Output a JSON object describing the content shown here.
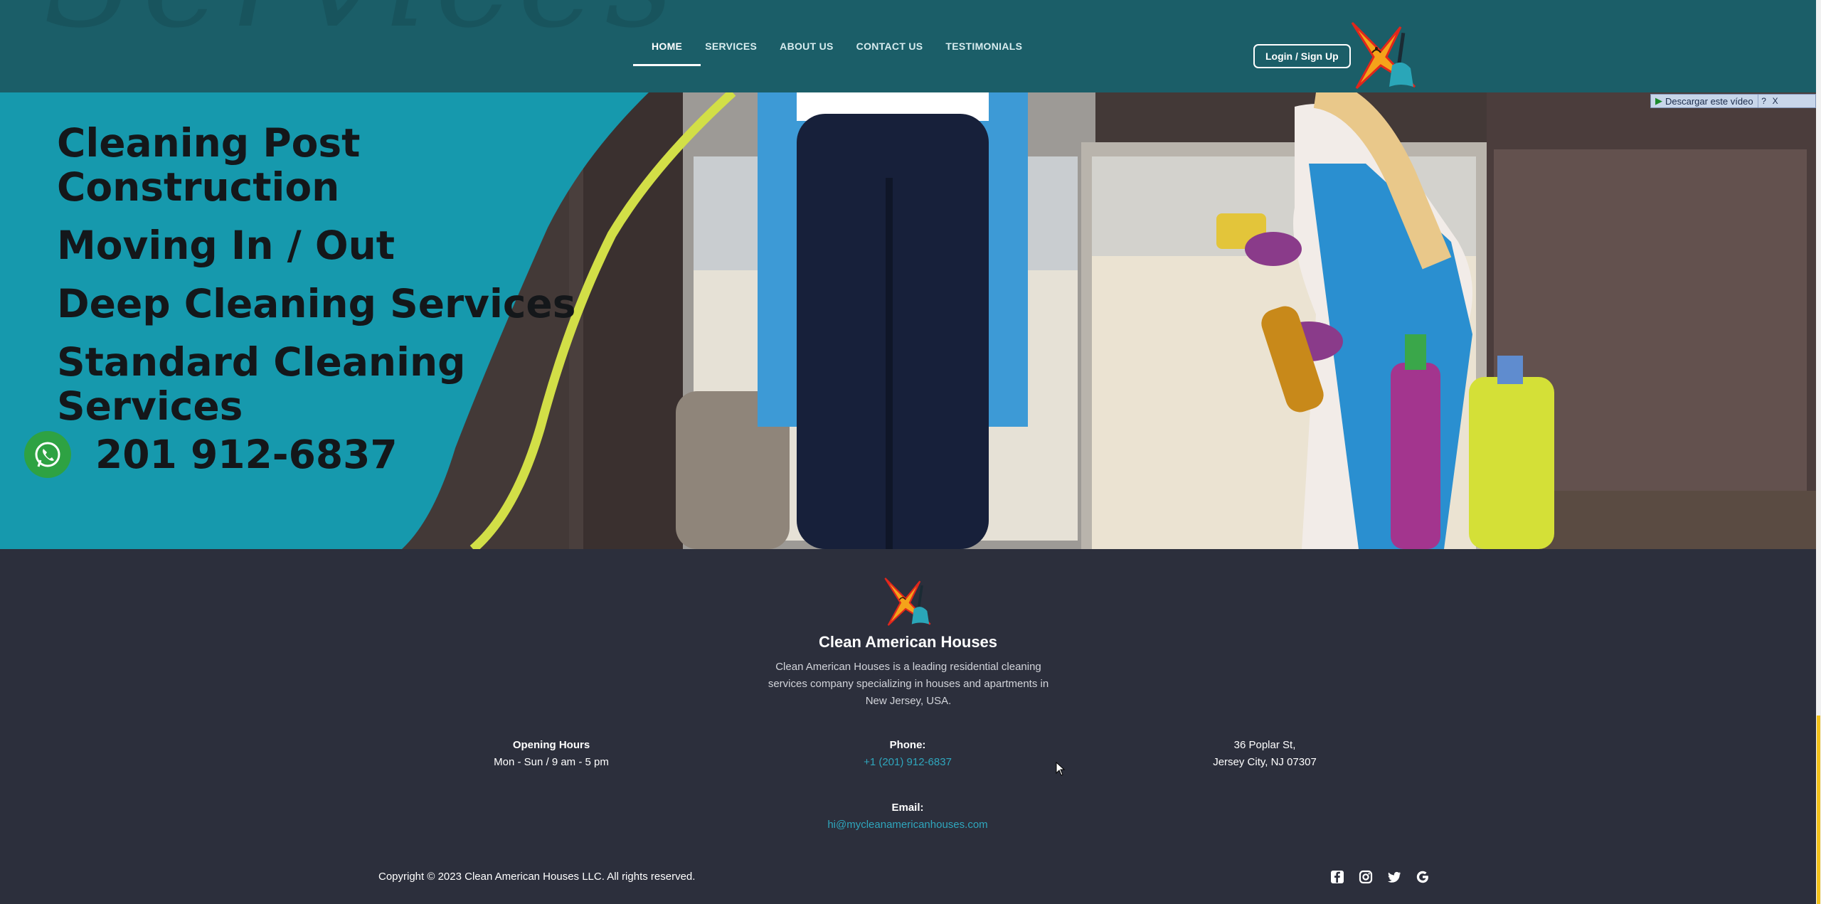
{
  "header": {
    "ghost_text": "Services",
    "nav": [
      {
        "label": "HOME",
        "active": true
      },
      {
        "label": "SERVICES",
        "active": false
      },
      {
        "label": "ABOUT US",
        "active": false
      },
      {
        "label": "CONTACT US",
        "active": false
      },
      {
        "label": "TESTIMONIALS",
        "active": false
      }
    ],
    "login_label": "Login / Sign Up",
    "logo_icon": "brand-logo-icon"
  },
  "hero": {
    "lines": [
      "Cleaning Post Construction",
      "Moving In / Out",
      "Deep Cleaning Services",
      "Standard Cleaning Services"
    ],
    "phone": "201 912-6837",
    "whatsapp_icon": "whatsapp-icon",
    "download_bar": {
      "label": "Descargar este vídeo",
      "help": "?",
      "close": "X"
    }
  },
  "footer": {
    "brand": "Clean American Houses",
    "description": "Clean American Houses is a leading residential cleaning services company specializing in houses and apartments in New Jersey, USA.",
    "hours_label": "Opening Hours",
    "hours_value": "Mon - Sun / 9 am - 5 pm",
    "phone_label": "Phone:",
    "phone_value": "+1 (201) 912-6837",
    "address_line1": "36 Poplar St,",
    "address_line2": "Jersey City, NJ 07307",
    "email_label": "Email:",
    "email_value": "hi@mycleanamericanhouses.com",
    "copyright": "Copyright © 2023 Clean American Houses LLC. All rights reserved.",
    "socials": [
      "facebook-icon",
      "instagram-icon",
      "twitter-icon",
      "google-icon"
    ]
  },
  "colors": {
    "header_bg": "#1b5e68",
    "teal_panel": "#1699ad",
    "footer_bg": "#2c2f3c",
    "link": "#2fa6bd",
    "scroll_thumb": "#f2c11a"
  }
}
